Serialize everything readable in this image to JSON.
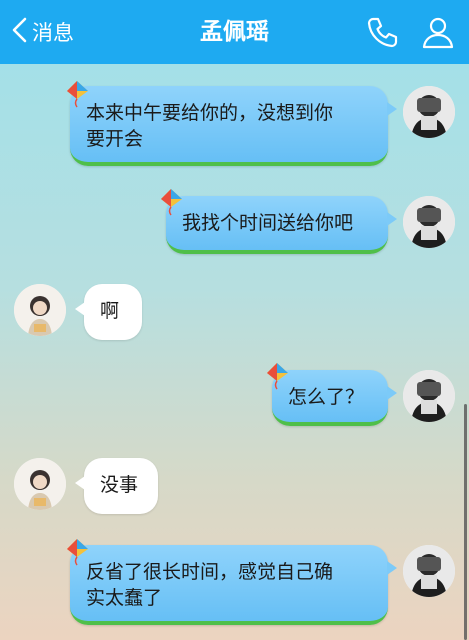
{
  "header": {
    "back_label": "消息",
    "title": "孟佩瑶",
    "bg_color": "#1eaaf1"
  },
  "messages": [
    {
      "from": "me",
      "text_line1": "本来中午要给你的，没想到你",
      "text_line2": "要开会"
    },
    {
      "from": "me",
      "text_line1": "我找个时间送给你吧"
    },
    {
      "from": "other",
      "text_line1": "啊"
    },
    {
      "from": "me",
      "text_line1": "怎么了？"
    },
    {
      "from": "other",
      "text_line1": "没事"
    },
    {
      "from": "me",
      "text_line1": "反省了很长时间，感觉自己确",
      "text_line2": "实太蠢了"
    }
  ]
}
